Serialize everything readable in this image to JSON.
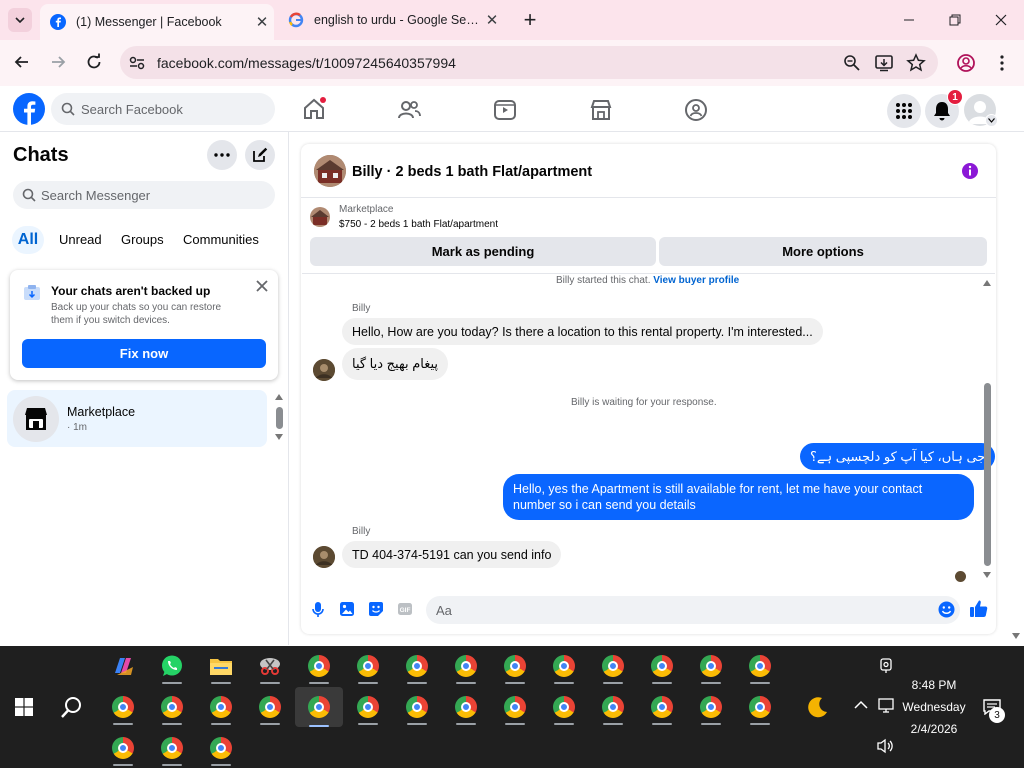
{
  "browser": {
    "tabs": [
      {
        "title": "(1) Messenger | Facebook",
        "active": true
      },
      {
        "title": "english to urdu - Google Search",
        "active": false
      }
    ],
    "url": "facebook.com/messages/t/10097245640357994"
  },
  "fb": {
    "search_placeholder": "Search Facebook",
    "notif_count": "1"
  },
  "sidebar": {
    "title": "Chats",
    "search_placeholder": "Search Messenger",
    "filters": [
      "All",
      "Unread",
      "Groups",
      "Communities"
    ],
    "backup": {
      "title": "Your chats aren't backed up",
      "body": "Back up your chats so you can restore them if you switch devices.",
      "button": "Fix now"
    },
    "conversations": [
      {
        "name": "Marketplace",
        "time": "· 1m"
      }
    ]
  },
  "chat": {
    "title": "Billy · 2 beds 1 bath Flat/apartment",
    "listing": {
      "label": "Marketplace",
      "detail": "$750 - 2 beds 1 bath Flat/apartment"
    },
    "buttons": {
      "pending": "Mark as pending",
      "more": "More options"
    },
    "started": "Billy started this chat.",
    "view_profile": "View buyer profile",
    "messages": [
      {
        "sender": "Billy",
        "text": "Hello, How are you today? Is there a location to this rental property. I'm interested..."
      },
      {
        "text": "پیغام بھیج دیا گیا"
      },
      {
        "system": "Billy is waiting for your response."
      },
      {
        "out": true,
        "text": "جی ہاں، کیا آپ کو دلچسپی ہے؟"
      },
      {
        "out": true,
        "text": "Hello, yes the Apartment is still available for rent, let me have your contact number so i can send you details"
      },
      {
        "sender": "Billy",
        "text": "TD 404-374-5191 can you send info"
      }
    ],
    "composer_placeholder": "Aa"
  },
  "taskbar": {
    "time": "8:48 PM",
    "day": "Wednesday",
    "date": "2/4/2026",
    "notif_count": "3"
  },
  "colors": {
    "fb_blue": "#0866ff",
    "bubble_out": "#0a66ff",
    "tab_bar": "#fce4ec",
    "taskbar": "#1f1f1f"
  }
}
